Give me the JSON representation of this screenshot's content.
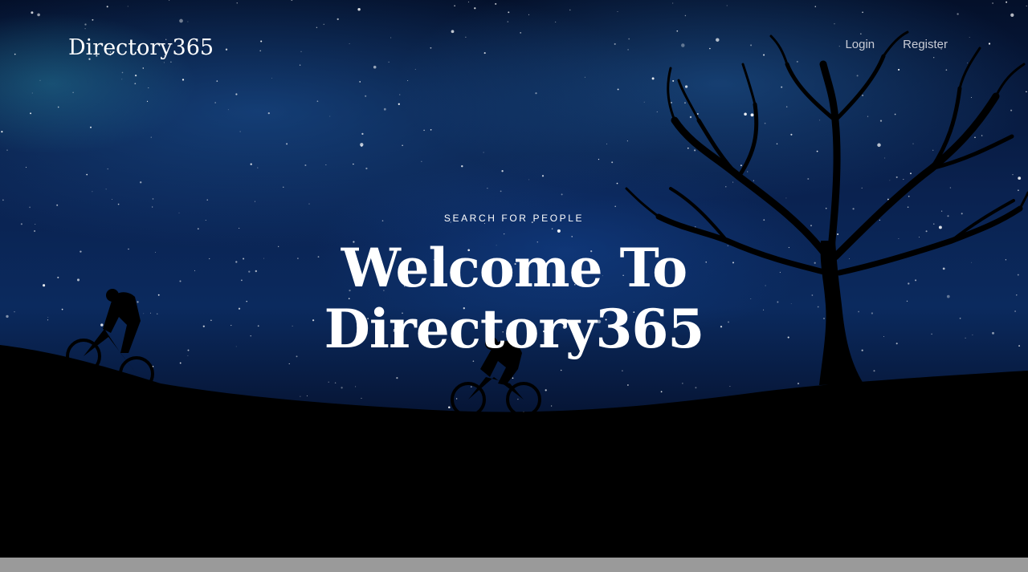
{
  "brand": {
    "name": "Directory365"
  },
  "nav": {
    "items": [
      {
        "label": "Login"
      },
      {
        "label": "Register"
      }
    ]
  },
  "hero": {
    "eyebrow": "SEARCH FOR PEOPLE",
    "headline_line1": "Welcome To",
    "headline_line2": "Directory365"
  },
  "colors": {
    "text": "#ffffff",
    "nav_text": "#c9ccd6",
    "sky_top": "#04102a",
    "sky_mid": "#0b2a5e",
    "ground": "#000000",
    "footer_strip": "#9a9a9a"
  }
}
